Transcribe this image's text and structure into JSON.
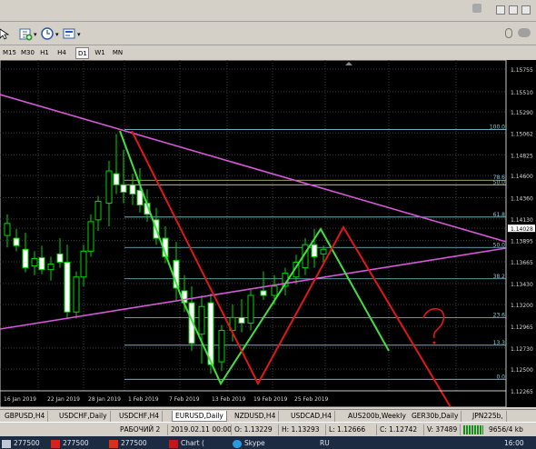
{
  "toolbar": {
    "zoom_icon": "add-chart-icon",
    "clock_icon": "clock-icon",
    "template_icon": "template-icon",
    "dropdown_arrow": "▾"
  },
  "menu": {
    "minimize": "minimize-icon",
    "restore": "restore-icon",
    "close": "close-icon"
  },
  "timeframes": [
    {
      "label": "M15"
    },
    {
      "label": "M30"
    },
    {
      "label": "H1"
    },
    {
      "label": "H4"
    },
    {
      "label": "D1",
      "active": true
    },
    {
      "label": "W1"
    },
    {
      "label": "MN"
    }
  ],
  "chart_data": {
    "type": "candlestick",
    "symbol": "EURUSD,Daily",
    "y_axis": {
      "min": 1.12265,
      "max": 1.15755,
      "ticks": [
        "1.15755",
        "1.15510",
        "1.15290",
        "1.15062",
        "1.14825",
        "1.14600",
        "1.14360",
        "1.14130",
        "1.14028",
        "1.13895",
        "1.13665",
        "1.13430",
        "1.13200",
        "1.12965",
        "1.12730",
        "1.12500",
        "1.12265"
      ],
      "current_price": "1.14028"
    },
    "x_labels": [
      "16 Jan 2019",
      "22 Jan 2019",
      "28 Jan 2019",
      "1 Feb 2019",
      "7 Feb 2019",
      "13 Feb 2019",
      "19 Feb 2019",
      "25 Feb 2019"
    ],
    "fibonacci": [
      {
        "label": "100.0",
        "price": 1.151
      },
      {
        "label": "78.6",
        "price": 1.1455
      },
      {
        "label": "50.0",
        "price": 1.145
      },
      {
        "label": "61.8",
        "price": 1.1415
      },
      {
        "label": "50.0",
        "price": 1.1382
      },
      {
        "label": "38.2",
        "price": 1.1348
      },
      {
        "label": "23.6",
        "price": 1.1306
      },
      {
        "label": "13.3",
        "price": 1.1276
      },
      {
        "label": "0.0",
        "price": 1.1239
      }
    ],
    "grid": true,
    "annotation": "?"
  },
  "tabs": [
    {
      "label": "GBPUSD,H4"
    },
    {
      "label": "USDCHF,Daily"
    },
    {
      "label": "USDCHF,H4"
    },
    {
      "label": "EURUSD,Daily",
      "active": true
    },
    {
      "label": "NZDUSD,H4"
    },
    {
      "label": "USDCAD,H4"
    },
    {
      "label": "AUS200b,Weekly"
    },
    {
      "label": "GER30b,Daily"
    },
    {
      "label": "JPN225b,"
    }
  ],
  "status": {
    "profile": "РАБОЧИЙ 2",
    "datetime": "2019.02.11 00:00",
    "open": "O: 1.13229",
    "high": "H: 1.13293",
    "low": "L: 1.12666",
    "close": "C: 1.12742",
    "volume": "V: 37489",
    "traffic": "9656/4 kb"
  },
  "taskbar": {
    "item1": "277500",
    "item2": "277500",
    "item3": "277500",
    "item4": "Chart (",
    "item5": "Skype",
    "lang": "RU",
    "time": "16:00"
  }
}
